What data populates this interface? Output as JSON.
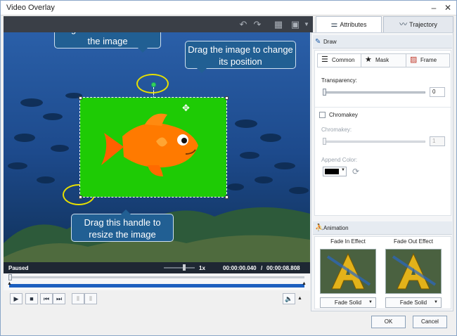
{
  "window": {
    "title": "Video Overlay",
    "minimize": "–",
    "close": "✕"
  },
  "tabs": [
    {
      "label": "Attributes",
      "icon": "attributes-icon"
    },
    {
      "label": "Trajectory",
      "icon": "trajectory-icon"
    }
  ],
  "callouts": {
    "rotate": "Drag this handle to rotate the image",
    "move": "Drag the image to change its position",
    "resize": "Drag this handle to resize the image"
  },
  "player": {
    "status": "Paused",
    "speed": "1x",
    "current_time": "00:00:00.040",
    "separator": "/",
    "total_time": "00:00:08.808"
  },
  "draw": {
    "section_label": "Draw",
    "subtabs": [
      {
        "label": "Common"
      },
      {
        "label": "Mask"
      },
      {
        "label": "Frame"
      }
    ],
    "transparency_label": "Transparency:",
    "transparency_value": "0",
    "chromakey_checkbox_label": "Chromakey",
    "chromakey_label": "Chromakey:",
    "chromakey_value": "1",
    "append_color_label": "Append Color:",
    "append_color": "#000000"
  },
  "animation": {
    "section_label": "Animation",
    "fade_in_label": "Fade In Effect",
    "fade_out_label": "Fade Out Effect",
    "fade_in_value": "Fade Solid",
    "fade_out_value": "Fade Solid"
  },
  "dialog": {
    "ok": "OK",
    "cancel": "Cancel"
  },
  "colors": {
    "overlay_bg": "#1ecb05",
    "callout_bg": "#215f93",
    "ring": "#e8e000",
    "timeline": "#1c5fbf"
  }
}
